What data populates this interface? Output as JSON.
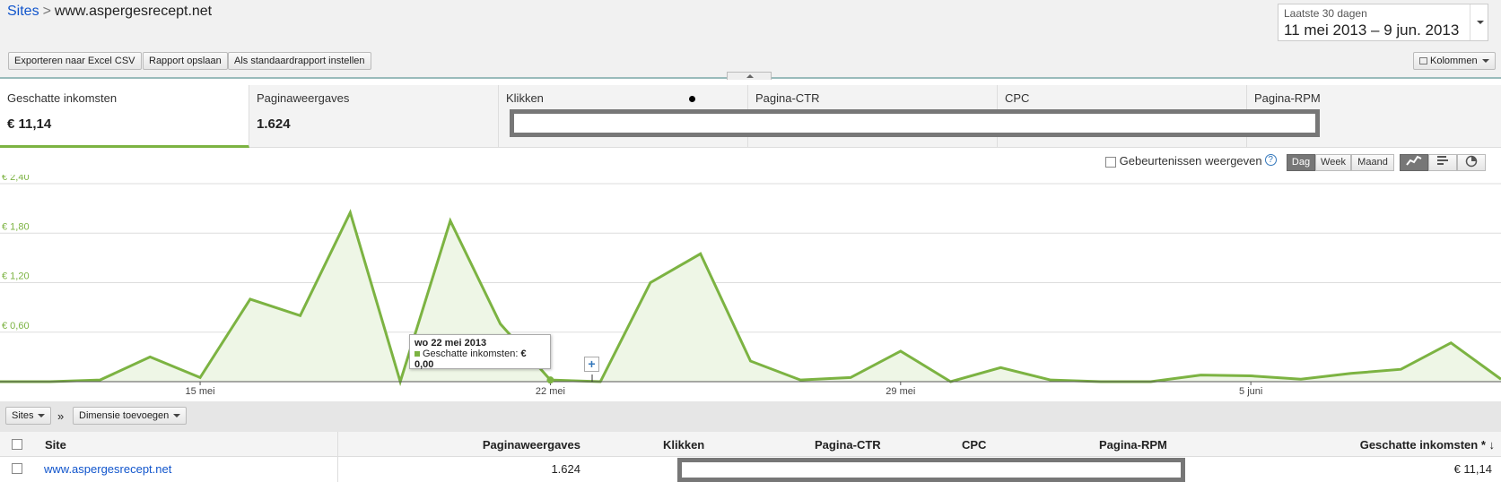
{
  "breadcrumb": {
    "root": "Sites",
    "separator": ">",
    "current": "www.aspergesrecept.net"
  },
  "date_range": {
    "label": "Laatste 30 dagen",
    "range": "11 mei 2013 – 9 jun. 2013"
  },
  "toolbar": {
    "export_label": "Exporteren naar Excel CSV",
    "save_label": "Rapport opslaan",
    "default_label": "Als standaardrapport instellen",
    "columns_label": "Kolommen"
  },
  "metrics": [
    {
      "name": "Geschatte inkomsten",
      "value": "€ 11,14"
    },
    {
      "name": "Paginaweergaves",
      "value": "1.624"
    },
    {
      "name": "Klikken",
      "value": ""
    },
    {
      "name": "Pagina-CTR",
      "value": ""
    },
    {
      "name": "CPC",
      "value": ""
    },
    {
      "name": "Pagina-RPM",
      "value": ""
    }
  ],
  "events_label": "Gebeurtenissen weergeven",
  "periods": [
    "Dag",
    "Week",
    "Maand"
  ],
  "chart_view_icons": [
    "line-chart-icon",
    "bar-chart-icon",
    "pie-chart-icon"
  ],
  "chart_data": {
    "type": "area",
    "series": [
      {
        "name": "Geschatte inkomsten",
        "color": "#7cb342",
        "values": [
          0,
          0,
          0.02,
          0.3,
          0.05,
          1.0,
          0.8,
          2.05,
          0,
          1.95,
          0.7,
          0.02,
          0,
          1.2,
          1.55,
          0.25,
          0.02,
          0.05,
          0.37,
          0,
          0.17,
          0.02,
          0,
          0,
          0.08,
          0.07,
          0.03,
          0.1,
          0.15,
          0.47,
          0.03
        ]
      }
    ],
    "x_ticks": [
      {
        "label": "15 mei",
        "index": 4
      },
      {
        "label": "22 mei",
        "index": 11
      },
      {
        "label": "29 mei",
        "index": 18
      },
      {
        "label": "5 juni",
        "index": 25
      }
    ],
    "y_ticks": [
      "€ 2,40",
      "€ 1,80",
      "€ 1,20",
      "€ 0,60"
    ],
    "y_tick_values": [
      2.4,
      1.8,
      1.2,
      0.6
    ],
    "ylim": [
      0,
      2.4
    ],
    "grid": true,
    "tooltip": {
      "date": "wo 22 mei 2013",
      "series_label": "Geschatte inkomsten:",
      "value": "€ 0,00"
    }
  },
  "dimension_bar": {
    "sites_label": "Sites",
    "separator": "»",
    "add_label": "Dimensie toevoegen"
  },
  "table": {
    "headers": [
      "Site",
      "Paginaweergaves",
      "Klikken",
      "Pagina-CTR",
      "CPC",
      "Pagina-RPM",
      "Geschatte inkomsten * ↓"
    ],
    "rows": [
      {
        "site": "www.aspergesrecept.net",
        "pageviews": "1.624",
        "revenue": "€ 11,14"
      }
    ]
  }
}
